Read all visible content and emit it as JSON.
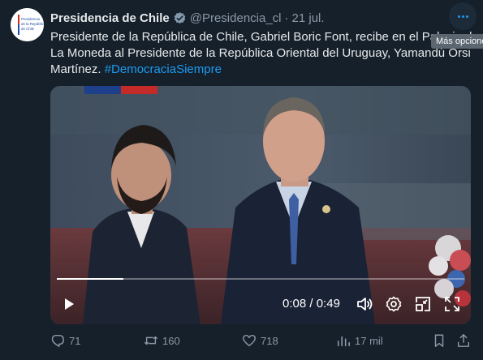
{
  "tweet": {
    "author_name": "Presidencia de Chile",
    "handle": "@Presidencia_cl",
    "separator": "·",
    "date": "21 jul.",
    "text": "Presidente de la República de Chile, Gabriel Boric Font, recibe en el Palacio de La Moneda al Presidente de la República Oriental del Uruguay, Yamandú Orsi Martínez.",
    "hashtag": "#DemocraciaSiempre",
    "avatar_text": [
      "Presidencia",
      "de la República",
      "de Chile"
    ]
  },
  "more_tooltip": "Más opciones",
  "video": {
    "current_time": "0:08",
    "time_separator": "/",
    "duration": "0:49",
    "progress": 0.163
  },
  "actions": {
    "replies": "71",
    "reposts": "160",
    "likes": "718",
    "views": "17 mil"
  },
  "colors": {
    "background": "#15202b",
    "accent": "#1d9bf0",
    "muted_text": "#8b98a5",
    "primary_text": "#e7e9ea"
  },
  "icons": [
    "more-icon",
    "verified-icon",
    "play-icon",
    "volume-icon",
    "settings-icon",
    "pip-icon",
    "fullscreen-icon",
    "reply-icon",
    "repost-icon",
    "like-icon",
    "views-icon",
    "bookmark-icon",
    "share-icon"
  ]
}
